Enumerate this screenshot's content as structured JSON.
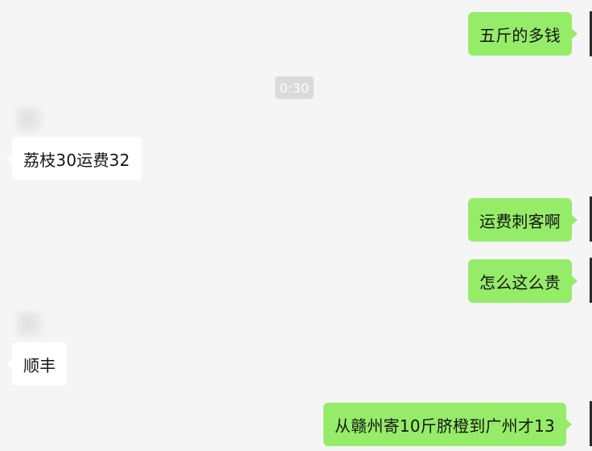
{
  "chat": {
    "timestamp": "0:30",
    "messages": [
      {
        "sender": "me",
        "text": "五斤的多钱"
      },
      {
        "sender": "other",
        "text": "荔枝30运费32"
      },
      {
        "sender": "me",
        "text": "运费刺客啊"
      },
      {
        "sender": "me",
        "text": "怎么这么贵"
      },
      {
        "sender": "other",
        "text": "顺丰"
      },
      {
        "sender": "me",
        "text": "从赣州寄10斤脐橙到广州才13"
      }
    ]
  },
  "colors": {
    "background": "#f5f5f5",
    "my_bubble": "#95ec69",
    "their_bubble": "#ffffff",
    "timestamp_bg": "#dadada",
    "text": "#151515"
  }
}
